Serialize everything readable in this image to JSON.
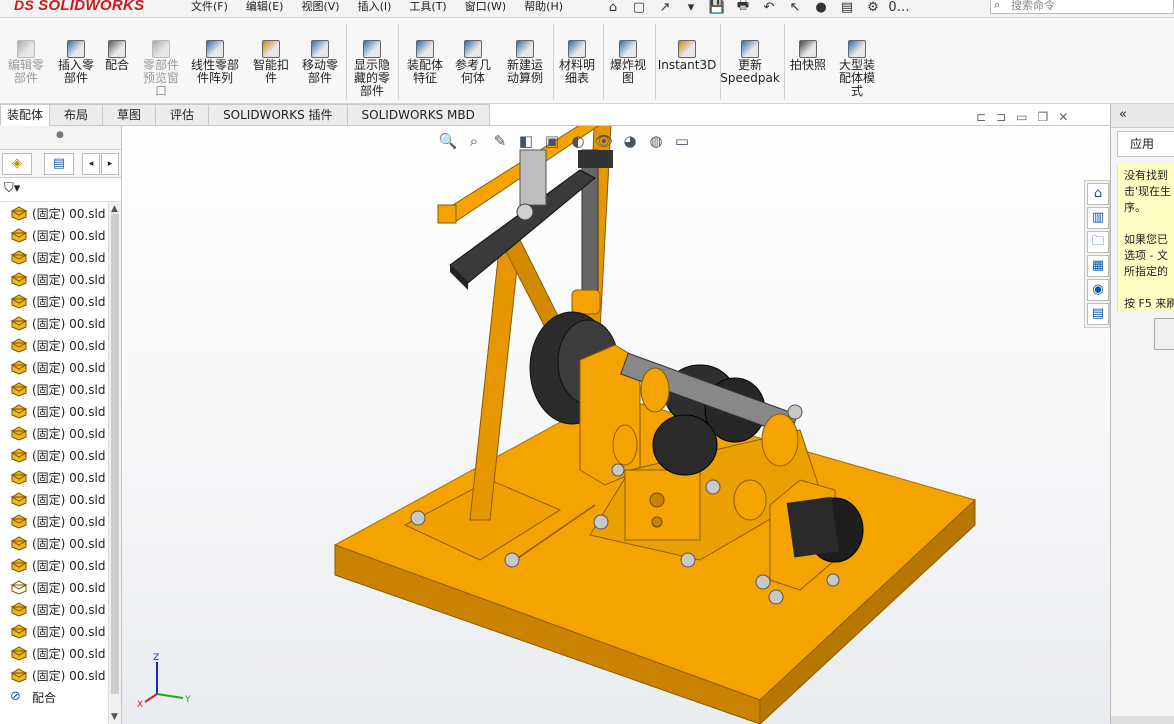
{
  "app": {
    "logo_prefix": "DS",
    "logo_text": "SOLIDWORKS"
  },
  "menu": [
    "文件(F)",
    "编辑(E)",
    "视图(V)",
    "插入(I)",
    "工具(T)",
    "窗口(W)",
    "帮助(H)"
  ],
  "quick_access": [
    "⌂",
    "▢",
    "↗",
    "▾",
    "💾",
    "🖶",
    "↶",
    "↖",
    "●",
    "▤",
    "⚙",
    "0…"
  ],
  "search": {
    "placeholder": "搜索命令"
  },
  "commands": [
    {
      "label": "编辑零\n部件",
      "icon": "edit-component-icon",
      "disabled": true
    },
    {
      "label": "插入零\n部件",
      "icon": "insert-component-icon",
      "disabled": false
    },
    {
      "label": "配合",
      "icon": "mate-icon",
      "disabled": false
    },
    {
      "label": "零部件\n预览窗\n口",
      "icon": "component-preview-icon",
      "disabled": true
    },
    {
      "label": "线性零部\n件阵列",
      "icon": "linear-pattern-icon",
      "disabled": false
    },
    {
      "label": "智能扣\n件",
      "icon": "smart-fastener-icon",
      "disabled": false
    },
    {
      "label": "移动零\n部件",
      "icon": "move-component-icon",
      "disabled": false
    },
    {
      "label": "显示隐\n藏的零\n部件",
      "icon": "show-hidden-icon",
      "disabled": false
    },
    {
      "label": "装配体\n特征",
      "icon": "assembly-feature-icon",
      "disabled": false
    },
    {
      "label": "参考几\n何体",
      "icon": "reference-geometry-icon",
      "disabled": false
    },
    {
      "label": "新建运\n动算例",
      "icon": "motion-study-icon",
      "disabled": false
    },
    {
      "label": "材料明\n细表",
      "icon": "bom-icon",
      "disabled": false
    },
    {
      "label": "爆炸视\n图",
      "icon": "exploded-view-icon",
      "disabled": false
    },
    {
      "label": "Instant3D",
      "icon": "instant3d-icon",
      "disabled": false
    },
    {
      "label": "更新\nSpeedpak",
      "icon": "speedpak-icon",
      "disabled": false
    },
    {
      "label": "拍快照",
      "icon": "snapshot-icon",
      "disabled": false
    },
    {
      "label": "大型装\n配体模\n式",
      "icon": "large-assembly-icon",
      "disabled": false
    }
  ],
  "tabs": [
    "装配体",
    "布局",
    "草图",
    "评估",
    "SOLIDWORKS 插件",
    "SOLIDWORKS MBD"
  ],
  "tree": {
    "items": [
      "(固定) 00.sld",
      "(固定) 00.sld",
      "(固定) 00.sld",
      "(固定) 00.sld",
      "(固定) 00.sld",
      "(固定) 00.sld",
      "(固定) 00.sld",
      "(固定) 00.sld",
      "(固定) 00.sld",
      "(固定) 00.sld",
      "(固定) 00.sld",
      "(固定) 00.sld",
      "(固定) 00.sld",
      "(固定) 00.sld",
      "(固定) 00.sld",
      "(固定) 00.sld",
      "(固定) 00.sld",
      "(固定) 00.sld",
      "(固定) 00.sld",
      "(固定) 00.sld",
      "(固定) 00.sld",
      "(固定) 00.sld"
    ],
    "mates_label": "配合"
  },
  "taskpane": {
    "tab": "应用",
    "message_lines": [
      "没有找到",
      "击'现在生",
      "序。",
      "",
      "如果您已",
      "选项 - 文",
      "所指定的",
      "",
      "按 F5 来刷"
    ]
  },
  "colors": {
    "accent_orange": "#f5a300",
    "steel_dark": "#2a2a2a",
    "note_yellow": "#ffffc4"
  }
}
